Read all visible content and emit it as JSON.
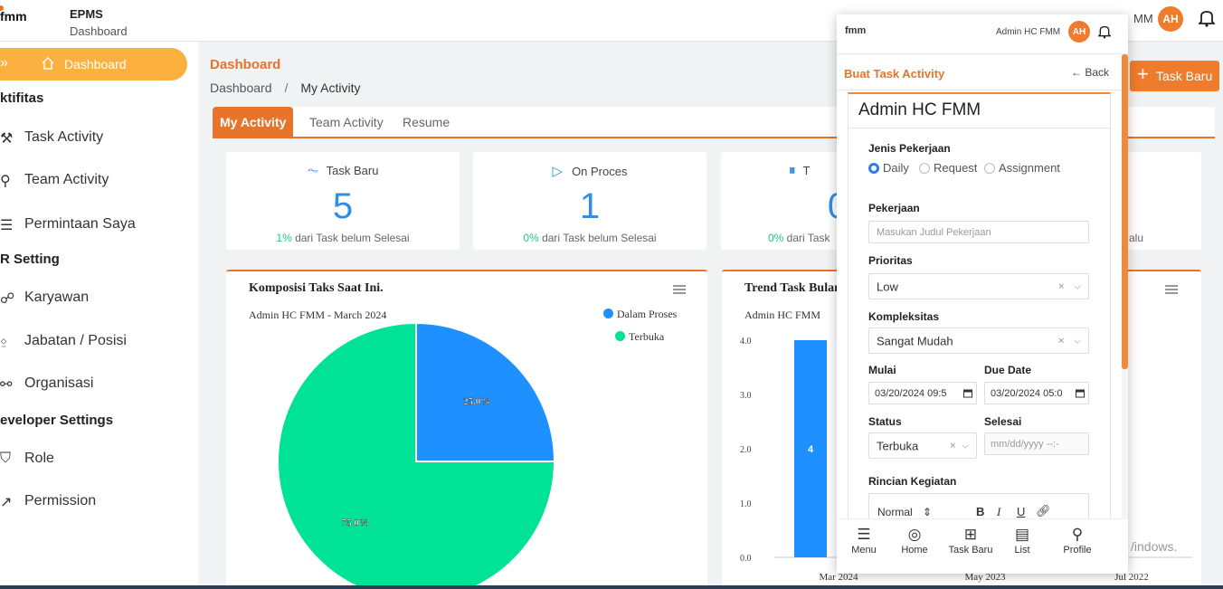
{
  "app": {
    "title": "EPMS",
    "subtitle": "Dashboard",
    "logo_text": "fmm"
  },
  "header": {
    "user_name_partial": "MM",
    "avatar_initials": "AH"
  },
  "sidebar": {
    "active_label": "Dashboard",
    "sections": [
      {
        "label": "ktifitas"
      },
      {
        "label": "R Setting"
      },
      {
        "label": "eveloper Settings"
      }
    ],
    "items": [
      {
        "label": "Task Activity"
      },
      {
        "label": "Team Activity"
      },
      {
        "label": "Permintaan Saya"
      },
      {
        "label": "Karyawan"
      },
      {
        "label": "Jabatan / Posisi"
      },
      {
        "label": "Organisasi"
      },
      {
        "label": "Role"
      },
      {
        "label": "Permission"
      }
    ]
  },
  "breadcrumb": {
    "title": "Dashboard",
    "root": "Dashboard",
    "separator": "/",
    "current": "My Activity"
  },
  "tabs": [
    {
      "label": "My Activity"
    },
    {
      "label": "Team Activity"
    },
    {
      "label": "Resume"
    }
  ],
  "new_task_button": "Task Baru",
  "stats": [
    {
      "label": "Task Baru",
      "value": "5",
      "pct": "1%",
      "note": " dari Task belum Selesai"
    },
    {
      "label": "On Proces",
      "value": "1",
      "pct": "0%",
      "note": " dari Task belum Selesai"
    },
    {
      "label": "T",
      "value": "0",
      "pct": "0%",
      "note": " dari Task"
    },
    {
      "note": "alu"
    }
  ],
  "pie_panel": {
    "title": "Komposisi Taks Saat Ini.",
    "subtitle": "Admin HC FMM - March 2024"
  },
  "trend_panel": {
    "title": "Trend Task Bulan",
    "subtitle": "Admin HC FMM",
    "bar_label": "4"
  },
  "chart_data": [
    {
      "type": "pie",
      "title": "Komposisi Taks Saat Ini.",
      "subtitle": "Admin HC FMM - March 2024",
      "categories": [
        "Dalam Proses",
        "Terbuka"
      ],
      "values": [
        25.0,
        75.0
      ],
      "labels": [
        "25.0%",
        "75.0%"
      ],
      "colors": [
        "#1e90ff",
        "#00e396"
      ],
      "legend": "top-right"
    },
    {
      "type": "bar",
      "title": "Trend Task Bulan",
      "subtitle": "Admin HC FMM",
      "categories": [
        "Mar 2024",
        "May 2023",
        "Jul 2022"
      ],
      "values": [
        4,
        null,
        null
      ],
      "yticks": [
        "4.0",
        "3.0",
        "2.0",
        "1.0",
        "0.0"
      ],
      "ylim": [
        0,
        4
      ],
      "colors": [
        "#1e90ff"
      ]
    }
  ],
  "modal": {
    "user_name": "Admin HC FMM",
    "avatar_initials": "AH",
    "title": "Buat Task Activity",
    "back_label": "Back",
    "name_heading": "Admin HC FMM",
    "jenis_label": "Jenis Pekerjaan",
    "jenis_options": [
      "Daily",
      "Request",
      "Assignment"
    ],
    "jenis_selected": "Daily",
    "pekerjaan_label": "Pekerjaan",
    "pekerjaan_placeholder": "Masukan Judul Pekerjaan",
    "prioritas_label": "Prioritas",
    "prioritas_value": "Low",
    "kompleksitas_label": "Kompleksitas",
    "kompleksitas_value": "Sangat Mudah",
    "mulai_label": "Mulai",
    "mulai_value": "03/20/2024 09:5",
    "due_label": "Due Date",
    "due_value": "03/20/2024 05:0",
    "status_label": "Status",
    "status_value": "Terbuka",
    "selesai_label": "Selesai",
    "selesai_placeholder": "mm/dd/yyyy --:-",
    "rincian_label": "Rincian Kegiatan",
    "editor_format": "Normal",
    "nav": [
      {
        "label": "Menu"
      },
      {
        "label": "Home"
      },
      {
        "label": "Task Baru"
      },
      {
        "label": "List"
      },
      {
        "label": "Profile"
      }
    ]
  },
  "watermark": "/indows."
}
